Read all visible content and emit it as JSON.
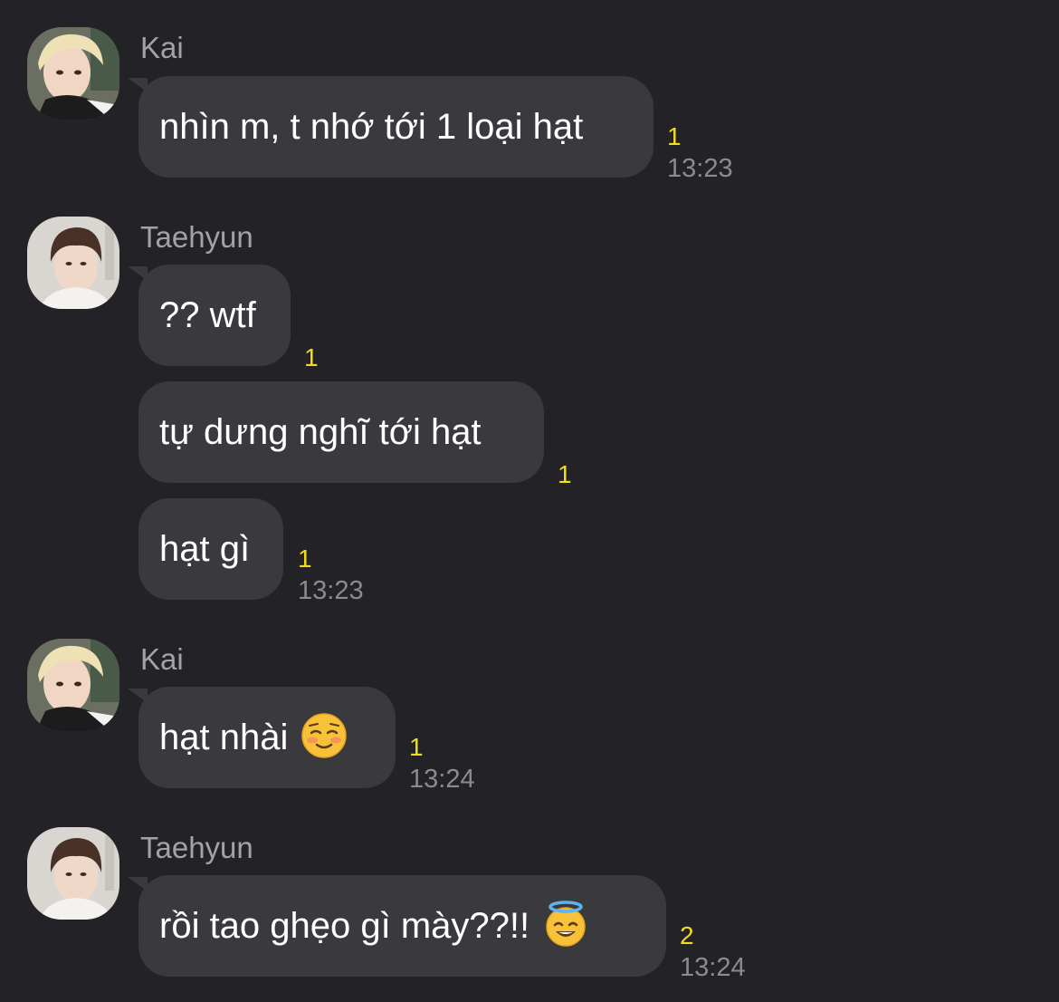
{
  "messages": [
    {
      "sender": "Kai",
      "text": "nhìn m, t nhớ tới 1 loại hạt",
      "unread": "1",
      "time": "13:23"
    },
    {
      "sender": "Taehyun",
      "text": "?? wtf",
      "unread": "1"
    },
    {
      "text": "tự dưng nghĩ tới hạt",
      "unread": "1"
    },
    {
      "text": "hạt gì",
      "unread": "1",
      "time": "13:23"
    },
    {
      "sender": "Kai",
      "text": "hạt nhài",
      "emoji": "smiling-blush-emoji",
      "unread": "1",
      "time": "13:24"
    },
    {
      "sender": "Taehyun",
      "text": "rồi tao ghẹo gì mày??!!",
      "emoji": "halo-smile-emoji",
      "unread": "2",
      "time": "13:24"
    }
  ],
  "colors": {
    "background": "#232226",
    "bubble": "#3a393e",
    "unread": "#f2dc1b",
    "time": "#8b8a8f",
    "sender": "#a3a2a7"
  }
}
